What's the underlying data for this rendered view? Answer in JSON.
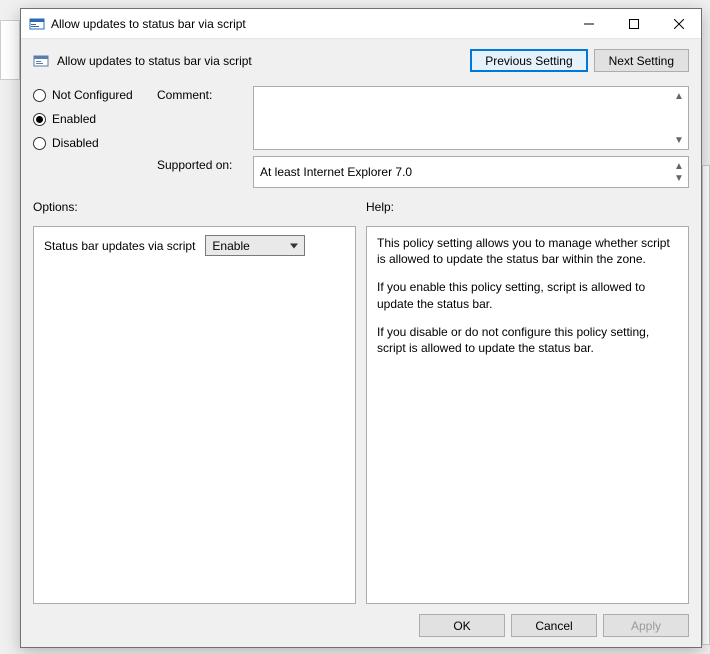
{
  "window": {
    "title": "Allow updates to status bar via script"
  },
  "header": {
    "title": "Allow updates to status bar via script",
    "previous_setting": "Previous Setting",
    "next_setting": "Next Setting"
  },
  "state": {
    "not_configured": "Not Configured",
    "enabled": "Enabled",
    "disabled": "Disabled",
    "selected": "enabled"
  },
  "fields": {
    "comment_label": "Comment:",
    "comment_value": "",
    "supported_label": "Supported on:",
    "supported_value": "At least Internet Explorer 7.0"
  },
  "sections": {
    "options_label": "Options:",
    "help_label": "Help:"
  },
  "options": {
    "item_label": "Status bar updates via script",
    "item_value": "Enable"
  },
  "help": {
    "p1": "This policy setting allows you to manage whether script is allowed to update the status bar within the zone.",
    "p2": "If you enable this policy setting, script is allowed to update the status bar.",
    "p3": "If you disable or do not configure this policy setting, script is allowed to update the status bar."
  },
  "footer": {
    "ok": "OK",
    "cancel": "Cancel",
    "apply": "Apply"
  }
}
